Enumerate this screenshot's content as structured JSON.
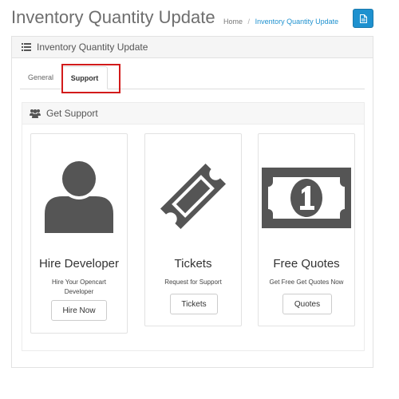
{
  "header": {
    "title": "Inventory Quantity Update",
    "breadcrumb": {
      "home": "Home",
      "separator": "/",
      "current": "Inventory Quantity Update"
    },
    "action_icon": "file-icon"
  },
  "panel": {
    "title": "Inventory Quantity Update",
    "icon": "list-icon"
  },
  "tabs": [
    {
      "label": "General",
      "active": false
    },
    {
      "label": "Support",
      "active": true
    }
  ],
  "support": {
    "title": "Get Support",
    "icon": "users-icon",
    "cards": [
      {
        "icon": "user-icon",
        "title": "Hire Developer",
        "description": "Hire Your Opencart Developer",
        "button": "Hire Now"
      },
      {
        "icon": "ticket-icon",
        "title": "Tickets",
        "description": "Request for Support",
        "button": "Tickets"
      },
      {
        "icon": "money-icon",
        "title": "Free Quotes",
        "description": "Get Free Get Quotes Now",
        "button": "Quotes"
      }
    ]
  },
  "colors": {
    "accent": "#1e91cf",
    "highlight": "#d21b1b",
    "icon": "#555555"
  }
}
